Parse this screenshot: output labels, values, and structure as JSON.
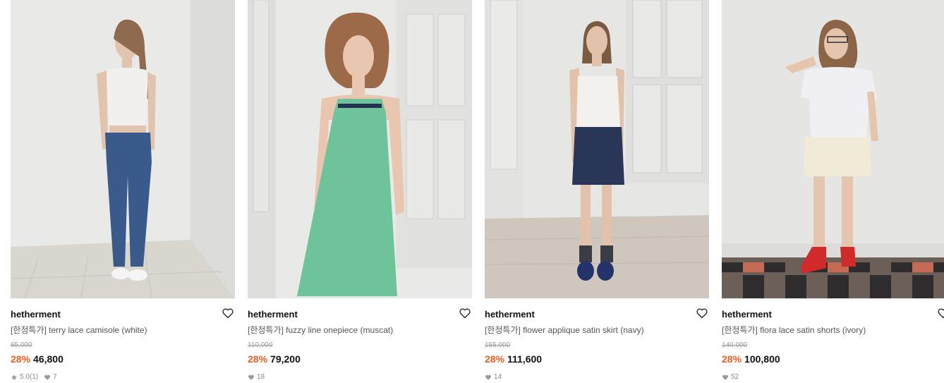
{
  "products": [
    {
      "brand": "hetherment",
      "name": "[한정특가] terry lace camisole (white)",
      "original_price": "65,000",
      "discount": "28%",
      "price": "46,800",
      "rating": "5.0",
      "review_count": "(1)",
      "likes": "7"
    },
    {
      "brand": "hetherment",
      "name": "[한정특가] fuzzy line onepiece (muscat)",
      "original_price": "110,000",
      "discount": "28%",
      "price": "79,200",
      "likes": "18"
    },
    {
      "brand": "hetherment",
      "name": "[한정특가] flower applique satin skirt (navy)",
      "original_price": "155,000",
      "discount": "28%",
      "price": "111,600",
      "likes": "14"
    },
    {
      "brand": "hetherment",
      "name": "[한정특가] flora lace satin shorts (ivory)",
      "original_price": "140,000",
      "discount": "28%",
      "price": "100,800",
      "likes": "52"
    }
  ],
  "colors": {
    "discount": "#f05a22",
    "brand_text": "#111111",
    "name_text": "#555555",
    "muted": "#9a9a9a"
  },
  "icons": {
    "wishlist": "heart-outline-icon",
    "rating": "star-icon",
    "likes": "heart-filled-icon"
  }
}
